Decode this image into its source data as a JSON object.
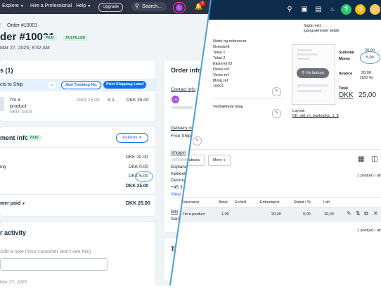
{
  "wix": {
    "topbar": {
      "explore": "Explore",
      "hire": "Hire a Professional",
      "help": "Help",
      "upgrade": "Upgrade",
      "search": "Search...",
      "avatar": "L",
      "notif_count": "5"
    },
    "breadcrumb": "Order #10001",
    "order_title": "der #10001",
    "badge_paid": "PAID",
    "badge_fulfilled": "FULFILLED",
    "order_date": "Mar 27, 2025, 8:52 AM",
    "items_header": "s (1)",
    "to_ship": "cts to Ship",
    "more": "•••",
    "add_tracking": "Add Tracking No.",
    "print_label": "Print Shipping Label",
    "product_name": "I'm a product",
    "sku": "SKU: 0004",
    "price": "DKK 25.00",
    "qty": "X 1",
    "line_total": "DKK 25.00",
    "payment_header": "ment info",
    "payment_badge": "PAID",
    "actions": "Actions",
    "subtotal": "DKK 20.00",
    "shipping_label": "ing",
    "shipping": "DKK 0.00",
    "tax": "DKK 5.00",
    "total": "DKK 25.00",
    "customer_paid_label": "mer paid",
    "customer_paid": "DKK 25.00",
    "activity_header": "r activity",
    "note_placeholder": "Add a note (Your customer won't see this)",
    "activity_date": "Mar 27, 2025",
    "order_info": "Order info",
    "contact_info": "Contact info",
    "contact_avatar": "LM",
    "delivery": "Delivery m",
    "free_ship": "Free Ship",
    "shipping_addr": "Shippin",
    "addr1": "Esplana",
    "addr2": "Københa",
    "addr3": "Denmark",
    "phone": "+45 3",
    "view": "View",
    "billing": "Billi",
    "billing2": "San",
    "tags": "Ta"
  },
  "eco": {
    "icons": [
      "search-icon",
      "inbox-icon",
      "document-icon",
      "apps-icon",
      "bell-icon",
      "help-icon",
      "settings-icon",
      "profile-icon"
    ],
    "saldo1": "Saldo inkl.",
    "saldo2": "igangværende beløb",
    "fields": [
      "Noter og referencer",
      "Overskrift",
      "Tekst 1",
      "Tekst 2",
      "Eksternt ID",
      "Deres ref.",
      "Vores ref.",
      "Øvrig ref."
    ],
    "ovrig_value": "10001",
    "attachments": "Vedhæftede bilag",
    "vis_faktura": "Vis faktura",
    "subtotal_label": "Subtotal",
    "subtotal": "20,00",
    "moms_label": "Moms",
    "moms": "5,00",
    "avance_label": "Avance",
    "avance": "20,00",
    "avance_pct": "(100 %)",
    "total_label": "Total",
    "currency": "DKK",
    "total": "25,00",
    "layout_label": "Layout:",
    "layout_value": "DK_std_m_bankoplys_1_8",
    "faktura_btn": "faktura",
    "mere_btn": "Mere",
    "posts1": "1 post(er) i alt",
    "cols": [
      "Varenavn",
      "Antal",
      "Enhed",
      "Enhedspris",
      "Rabat i %",
      "I alt"
    ],
    "row": {
      "name": "I'm a product",
      "qty": "1,00",
      "unit": "",
      "price": "20,00",
      "discount": "0,00",
      "total": "20,00"
    },
    "posts2": "1 post(er) i alt"
  },
  "colors": {
    "wix_nav": "#2b3244",
    "wix_blue": "#116dff",
    "eco_nav": "#0d2b4a",
    "highlight": "#4a9fd8"
  }
}
